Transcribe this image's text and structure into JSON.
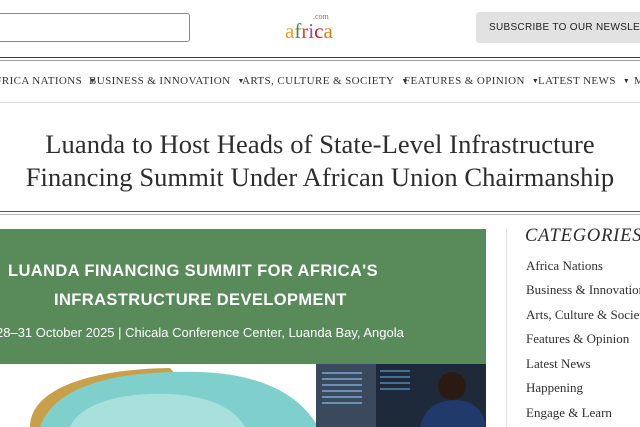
{
  "header": {
    "logo": {
      "com": ".com",
      "word": "africa",
      "letters": [
        "a",
        "f",
        "r",
        "i",
        "c",
        "a"
      ],
      "letter_colors": [
        "#e8a21a",
        "#4c8b3d",
        "#d64b26",
        "#8a4fa0",
        "#c8202f",
        "#e07b1f"
      ]
    },
    "subscribe_label": "SUBSCRIBE TO OUR NEWSLETTER",
    "search_placeholder": ""
  },
  "nav": {
    "items": [
      {
        "label": "AFRICA NATIONS"
      },
      {
        "label": "BUSINESS & INNOVATION"
      },
      {
        "label": "ARTS, CULTURE & SOCIETY"
      },
      {
        "label": "FEATURES & OPINION"
      },
      {
        "label": "LATEST NEWS"
      },
      {
        "label": "M"
      }
    ]
  },
  "article": {
    "headline_line1": "Luanda to Host Heads of State-Level Infrastructure",
    "headline_line2": "Financing Summit Under African Union Chairmanship",
    "banner": {
      "title_line1": "LUANDA FINANCING SUMMIT FOR AFRICA'S",
      "title_line2": "INFRASTRUCTURE DEVELOPMENT",
      "subtitle": "28–31 October 2025 | Chicala Conference Center, Luanda Bay, Angola",
      "colors": {
        "green": "#588a5a",
        "teal": "#7fd0cc",
        "gold": "#c9a04a",
        "navy": "#1f3a6b"
      }
    }
  },
  "sidebar": {
    "title": "CATEGORIES",
    "items": [
      {
        "label": "Africa Nations"
      },
      {
        "label": "Business & Innovation"
      },
      {
        "label": "Arts, Culture & Society"
      },
      {
        "label": "Features & Opinion"
      },
      {
        "label": "Latest News"
      },
      {
        "label": "Happening"
      },
      {
        "label": "Engage & Learn"
      }
    ]
  }
}
